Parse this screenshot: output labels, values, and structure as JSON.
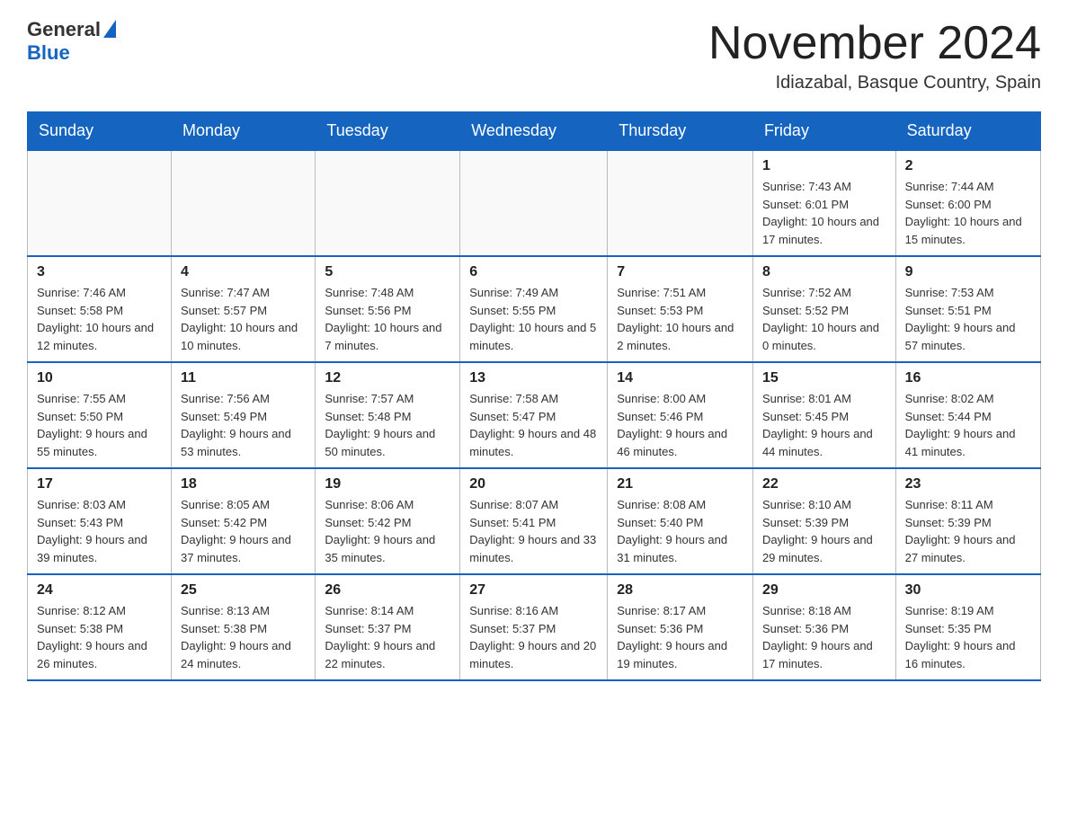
{
  "header": {
    "logo_general": "General",
    "logo_blue": "Blue",
    "title": "November 2024",
    "subtitle": "Idiazabal, Basque Country, Spain"
  },
  "calendar": {
    "days_of_week": [
      "Sunday",
      "Monday",
      "Tuesday",
      "Wednesday",
      "Thursday",
      "Friday",
      "Saturday"
    ],
    "weeks": [
      [
        {
          "day": "",
          "info": ""
        },
        {
          "day": "",
          "info": ""
        },
        {
          "day": "",
          "info": ""
        },
        {
          "day": "",
          "info": ""
        },
        {
          "day": "",
          "info": ""
        },
        {
          "day": "1",
          "info": "Sunrise: 7:43 AM\nSunset: 6:01 PM\nDaylight: 10 hours and 17 minutes."
        },
        {
          "day": "2",
          "info": "Sunrise: 7:44 AM\nSunset: 6:00 PM\nDaylight: 10 hours and 15 minutes."
        }
      ],
      [
        {
          "day": "3",
          "info": "Sunrise: 7:46 AM\nSunset: 5:58 PM\nDaylight: 10 hours and 12 minutes."
        },
        {
          "day": "4",
          "info": "Sunrise: 7:47 AM\nSunset: 5:57 PM\nDaylight: 10 hours and 10 minutes."
        },
        {
          "day": "5",
          "info": "Sunrise: 7:48 AM\nSunset: 5:56 PM\nDaylight: 10 hours and 7 minutes."
        },
        {
          "day": "6",
          "info": "Sunrise: 7:49 AM\nSunset: 5:55 PM\nDaylight: 10 hours and 5 minutes."
        },
        {
          "day": "7",
          "info": "Sunrise: 7:51 AM\nSunset: 5:53 PM\nDaylight: 10 hours and 2 minutes."
        },
        {
          "day": "8",
          "info": "Sunrise: 7:52 AM\nSunset: 5:52 PM\nDaylight: 10 hours and 0 minutes."
        },
        {
          "day": "9",
          "info": "Sunrise: 7:53 AM\nSunset: 5:51 PM\nDaylight: 9 hours and 57 minutes."
        }
      ],
      [
        {
          "day": "10",
          "info": "Sunrise: 7:55 AM\nSunset: 5:50 PM\nDaylight: 9 hours and 55 minutes."
        },
        {
          "day": "11",
          "info": "Sunrise: 7:56 AM\nSunset: 5:49 PM\nDaylight: 9 hours and 53 minutes."
        },
        {
          "day": "12",
          "info": "Sunrise: 7:57 AM\nSunset: 5:48 PM\nDaylight: 9 hours and 50 minutes."
        },
        {
          "day": "13",
          "info": "Sunrise: 7:58 AM\nSunset: 5:47 PM\nDaylight: 9 hours and 48 minutes."
        },
        {
          "day": "14",
          "info": "Sunrise: 8:00 AM\nSunset: 5:46 PM\nDaylight: 9 hours and 46 minutes."
        },
        {
          "day": "15",
          "info": "Sunrise: 8:01 AM\nSunset: 5:45 PM\nDaylight: 9 hours and 44 minutes."
        },
        {
          "day": "16",
          "info": "Sunrise: 8:02 AM\nSunset: 5:44 PM\nDaylight: 9 hours and 41 minutes."
        }
      ],
      [
        {
          "day": "17",
          "info": "Sunrise: 8:03 AM\nSunset: 5:43 PM\nDaylight: 9 hours and 39 minutes."
        },
        {
          "day": "18",
          "info": "Sunrise: 8:05 AM\nSunset: 5:42 PM\nDaylight: 9 hours and 37 minutes."
        },
        {
          "day": "19",
          "info": "Sunrise: 8:06 AM\nSunset: 5:42 PM\nDaylight: 9 hours and 35 minutes."
        },
        {
          "day": "20",
          "info": "Sunrise: 8:07 AM\nSunset: 5:41 PM\nDaylight: 9 hours and 33 minutes."
        },
        {
          "day": "21",
          "info": "Sunrise: 8:08 AM\nSunset: 5:40 PM\nDaylight: 9 hours and 31 minutes."
        },
        {
          "day": "22",
          "info": "Sunrise: 8:10 AM\nSunset: 5:39 PM\nDaylight: 9 hours and 29 minutes."
        },
        {
          "day": "23",
          "info": "Sunrise: 8:11 AM\nSunset: 5:39 PM\nDaylight: 9 hours and 27 minutes."
        }
      ],
      [
        {
          "day": "24",
          "info": "Sunrise: 8:12 AM\nSunset: 5:38 PM\nDaylight: 9 hours and 26 minutes."
        },
        {
          "day": "25",
          "info": "Sunrise: 8:13 AM\nSunset: 5:38 PM\nDaylight: 9 hours and 24 minutes."
        },
        {
          "day": "26",
          "info": "Sunrise: 8:14 AM\nSunset: 5:37 PM\nDaylight: 9 hours and 22 minutes."
        },
        {
          "day": "27",
          "info": "Sunrise: 8:16 AM\nSunset: 5:37 PM\nDaylight: 9 hours and 20 minutes."
        },
        {
          "day": "28",
          "info": "Sunrise: 8:17 AM\nSunset: 5:36 PM\nDaylight: 9 hours and 19 minutes."
        },
        {
          "day": "29",
          "info": "Sunrise: 8:18 AM\nSunset: 5:36 PM\nDaylight: 9 hours and 17 minutes."
        },
        {
          "day": "30",
          "info": "Sunrise: 8:19 AM\nSunset: 5:35 PM\nDaylight: 9 hours and 16 minutes."
        }
      ]
    ]
  }
}
